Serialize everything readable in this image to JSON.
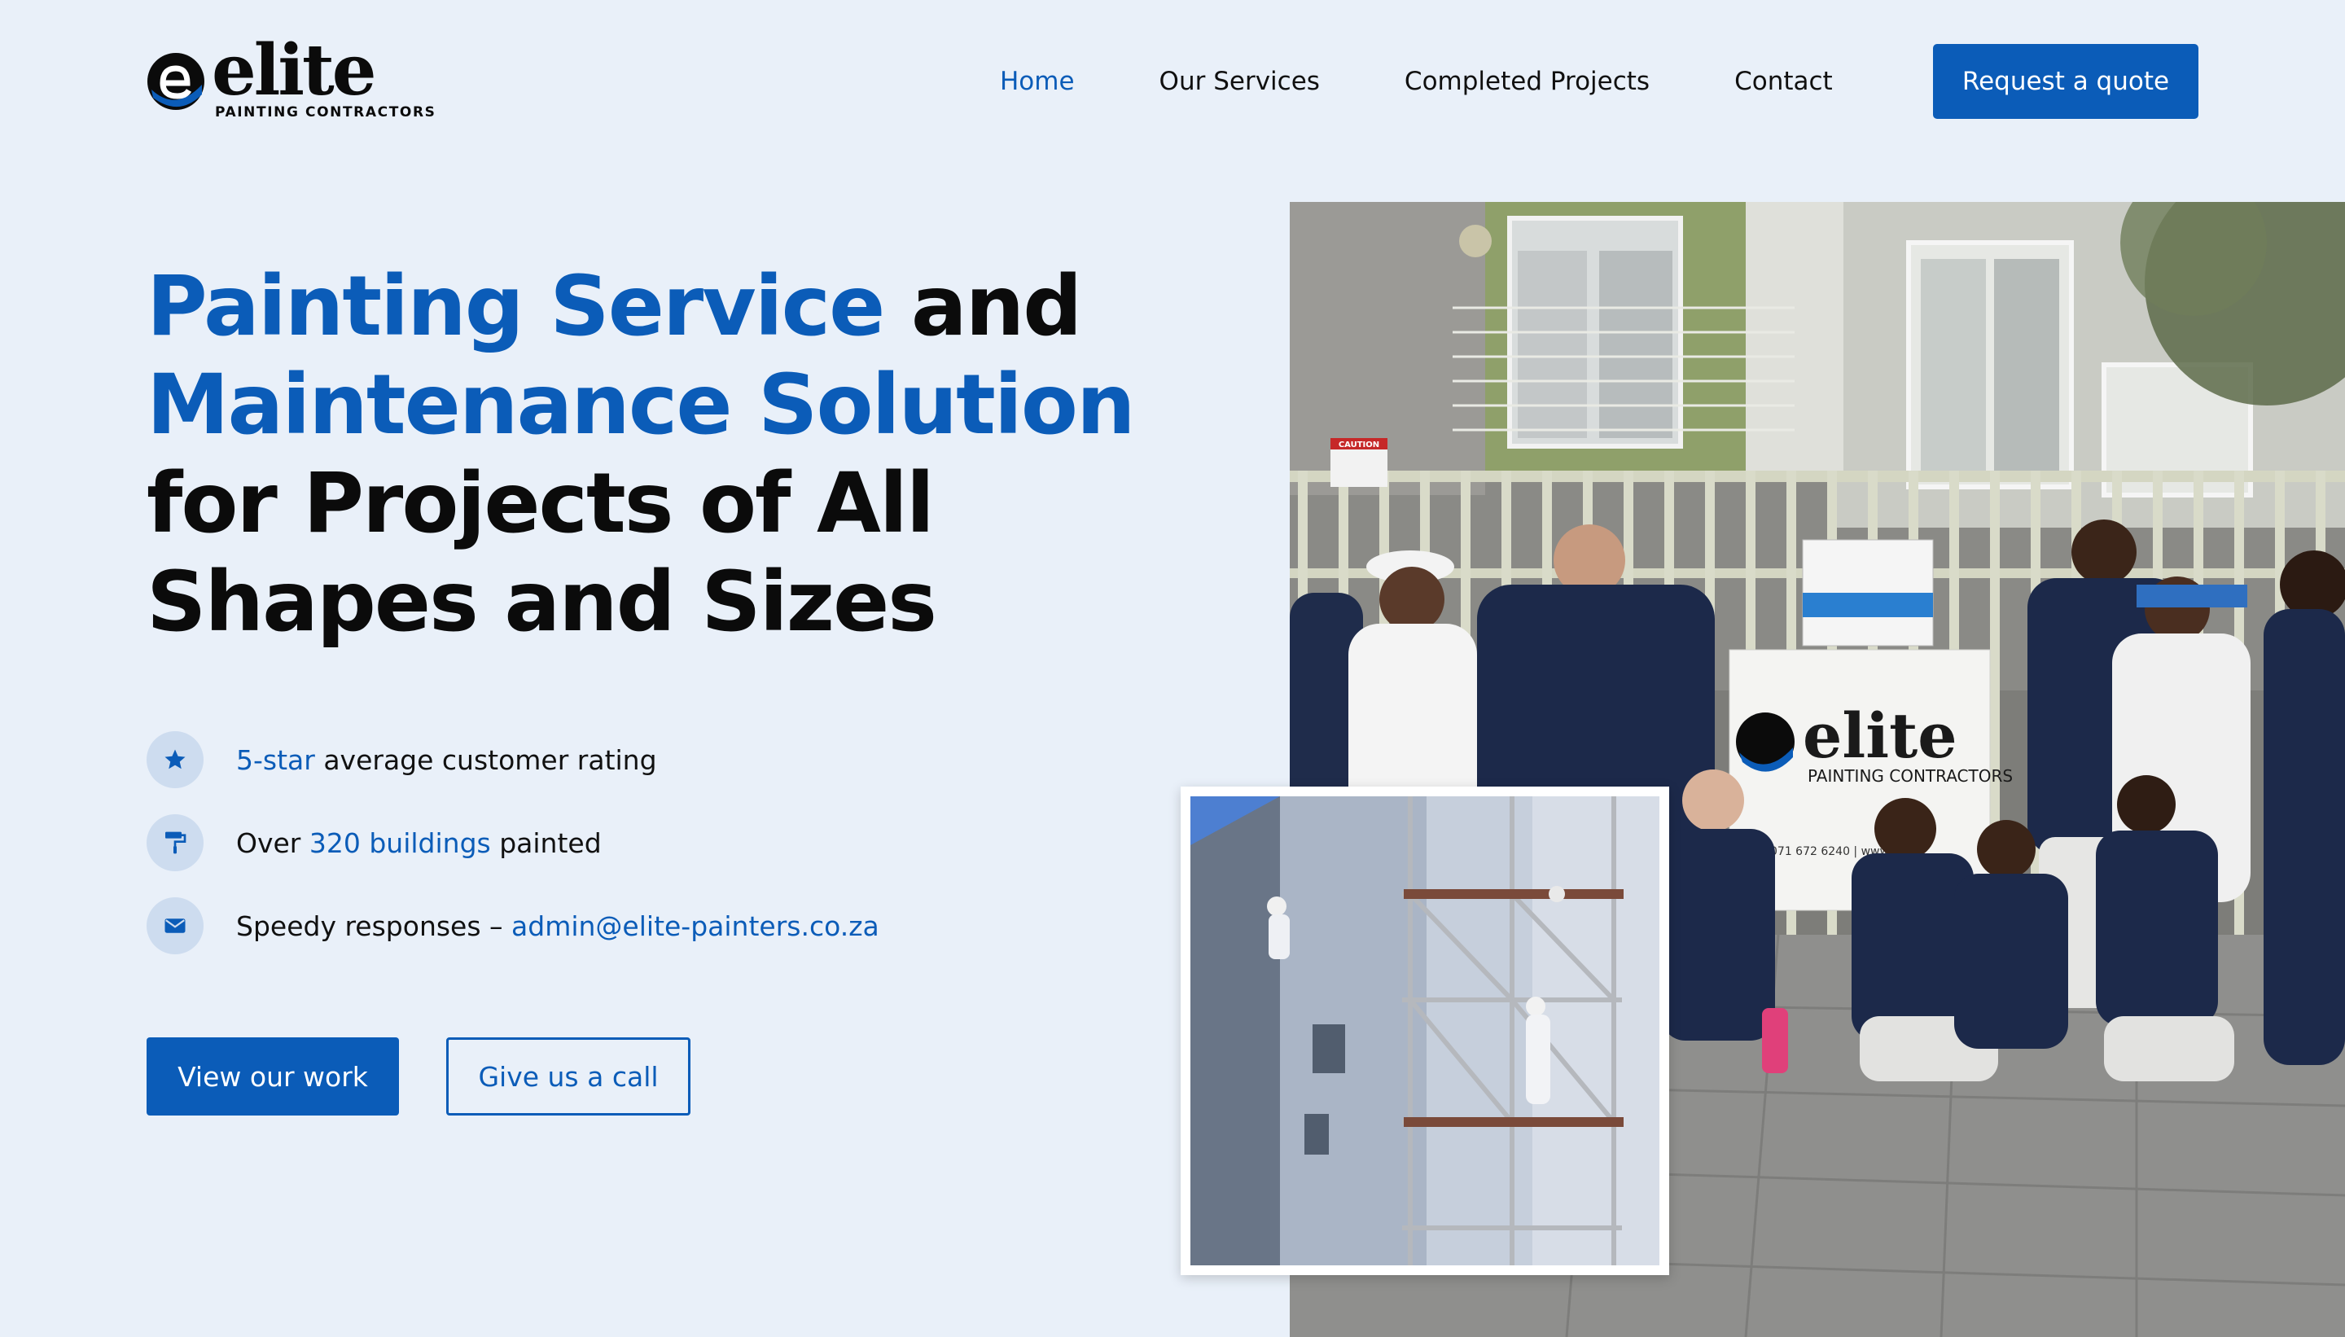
{
  "brand": {
    "name": "elite",
    "tagline": "PAINTING CONTRACTORS",
    "logo_icon": "elite-e-logo-icon",
    "colors": {
      "primary": "#0b5cb8",
      "background": "#e9f0f9",
      "icon_bg": "#cddcef",
      "text": "#0c0c0c"
    }
  },
  "nav": {
    "items": [
      {
        "label": "Home",
        "active": true
      },
      {
        "label": "Our Services",
        "active": false
      },
      {
        "label": "Completed Projects",
        "active": false
      },
      {
        "label": "Contact",
        "active": false
      }
    ],
    "cta_label": "Request a quote"
  },
  "hero": {
    "title": {
      "line1_blue": "Painting Service",
      "line1_rest": " and",
      "line2_blue": "Maintenance Solution",
      "line3": "for Projects of All",
      "line4": "Shapes and Sizes"
    },
    "features": [
      {
        "icon": "star-icon",
        "highlight": "5-star",
        "text": " average customer rating"
      },
      {
        "icon": "paint-roller-icon",
        "prefix": "Over ",
        "highlight": "320 buildings",
        "text": " painted"
      },
      {
        "icon": "envelope-icon",
        "prefix": "Speedy responses – ",
        "highlight": "admin@elite-painters.co.za"
      }
    ],
    "primary_button": "View our work",
    "secondary_button": "Give us a call"
  },
  "images": {
    "team_photo": {
      "sign_brand": "elite",
      "sign_tagline": "PAINTING CONTRACTORS",
      "sign_phone": "071 672 6240 | www",
      "caution": "CAUTION"
    },
    "scaffold_photo": {}
  }
}
